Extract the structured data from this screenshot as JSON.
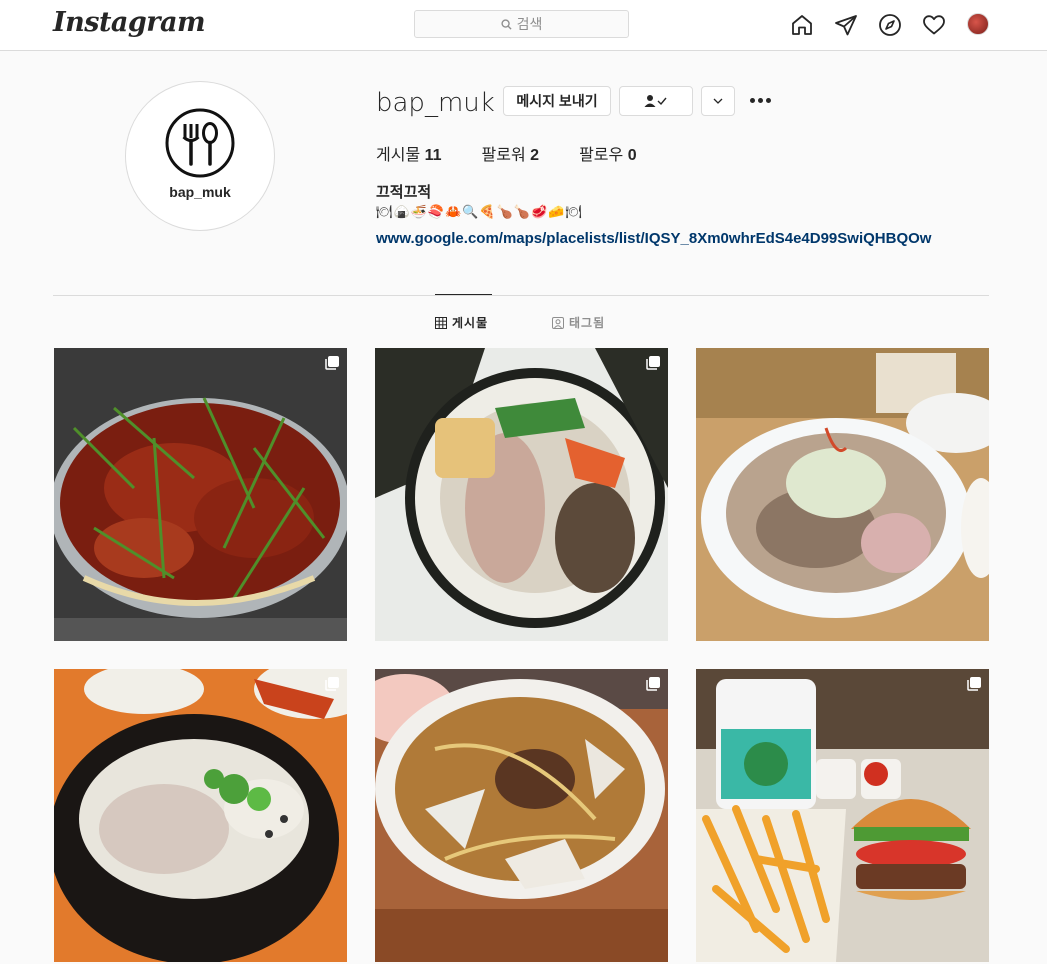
{
  "nav": {
    "logo": "Instagram",
    "search_placeholder": "검색",
    "icons": [
      "home-icon",
      "direct-icon",
      "explore-icon",
      "activity-heart-icon",
      "profile-avatar"
    ]
  },
  "profile": {
    "pic_label": "bap_muk",
    "username": "bap_muk",
    "message_button": "메시지 보내기",
    "stats": {
      "posts_label": "게시물",
      "posts_count": "11",
      "followers_label": "팔로워",
      "followers_count": "2",
      "following_label": "팔로우",
      "following_count": "0"
    },
    "bio_name": "끄적끄적",
    "bio_emoji": "🍽🍙🍜🍣🦀🔍🍕🍗🍗🥩🧀🍽",
    "bio_link": "www.google.com/maps/placelists/list/IQSY_8Xm0whrEdS4e4D99SwiQHBQOw"
  },
  "tabs": {
    "posts": "게시물",
    "tagged": "태그됨"
  },
  "posts": [
    {
      "name": "post-spicy-noodle-platter",
      "multi": true
    },
    {
      "name": "post-kimbap-closeup",
      "multi": true
    },
    {
      "name": "post-beef-noodle-soup",
      "multi": false
    },
    {
      "name": "post-pork-gukbap",
      "multi": true
    },
    {
      "name": "post-dumpling-noodle-soup",
      "multi": true
    },
    {
      "name": "post-burger-fries",
      "multi": true
    }
  ],
  "colors": {
    "link": "#00376b",
    "border": "#dbdbdb",
    "muted": "#8e8e8e",
    "text": "#262626"
  }
}
